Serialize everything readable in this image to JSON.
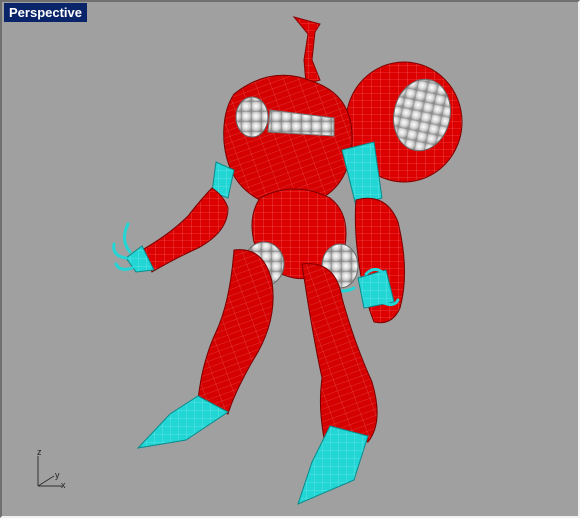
{
  "viewport": {
    "title": "Perspective",
    "background": "#a0a0a0",
    "title_bg": "#0a246a",
    "title_fg": "#ffffff"
  },
  "model": {
    "body_color": "#e00000",
    "accent_color": "#20d8d8",
    "dome_color": "#d4d4d4"
  },
  "axes": {
    "z": "z",
    "y": "y",
    "x": "x"
  }
}
